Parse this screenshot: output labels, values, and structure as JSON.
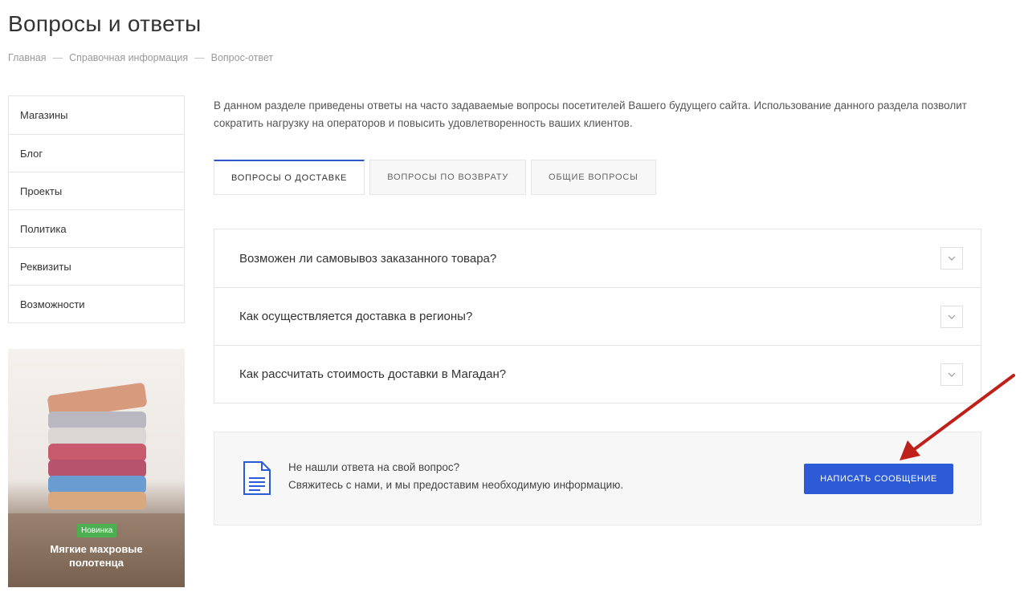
{
  "page": {
    "title": "Вопросы и ответы",
    "breadcrumb": [
      "Главная",
      "Справочная информация",
      "Вопрос-ответ"
    ]
  },
  "sidebar": {
    "items": [
      {
        "label": "Магазины"
      },
      {
        "label": "Блог"
      },
      {
        "label": "Проекты"
      },
      {
        "label": "Политика"
      },
      {
        "label": "Реквизиты"
      },
      {
        "label": "Возможности"
      }
    ]
  },
  "promo": {
    "badge": "Новинка",
    "caption_line1": "Мягкие махровые",
    "caption_line2": "полотенца",
    "towel_colors": [
      "#d89a7c",
      "#b9b7bf",
      "#d9d6d4",
      "#c75a6d",
      "#b8536d",
      "#6a9bd1",
      "#d8a87e"
    ]
  },
  "intro": {
    "text": "В данном разделе приведены ответы на часто задаваемые вопросы посетителей Вашего будущего сайта. Использование данного раздела позволит сократить нагрузку на операторов и повысить удовлетворенность ваших клиентов."
  },
  "tabs": [
    {
      "label": "ВОПРОСЫ О ДОСТАВКЕ",
      "active": true
    },
    {
      "label": "ВОПРОСЫ ПО ВОЗВРАТУ",
      "active": false
    },
    {
      "label": "ОБЩИЕ ВОПРОСЫ",
      "active": false
    }
  ],
  "faq": [
    {
      "question": "Возможен ли самовывоз заказанного товара?"
    },
    {
      "question": "Как осуществляется доставка в регионы?"
    },
    {
      "question": "Как рассчитать стоимость доставки в Магадан?"
    }
  ],
  "contact": {
    "line1": "Не нашли ответа на свой вопрос?",
    "line2": "Свяжитесь с нами, и мы предоставим необходимую информацию.",
    "button_label": "НАПИСАТЬ СООБЩЕНИЕ"
  },
  "colors": {
    "accent": "#2d5bd8",
    "arrow": "#c0201a",
    "badge": "#4caf50"
  },
  "icons": {
    "faq_toggle": "chevron-down-icon",
    "contact": "document-icon",
    "annotation": "red-arrow-icon"
  }
}
